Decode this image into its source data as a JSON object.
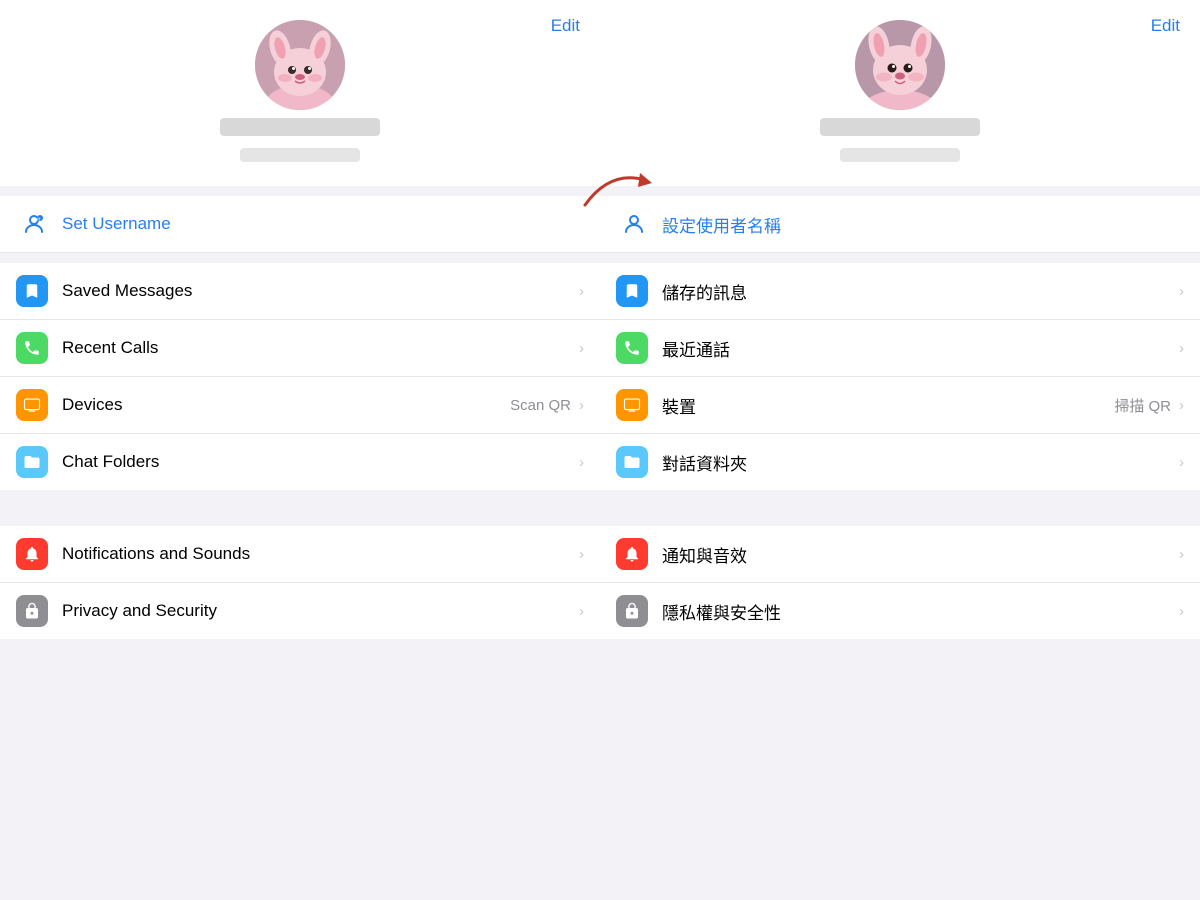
{
  "left": {
    "edit_label": "Edit",
    "username_icon": "👤",
    "username_label": "Set Username",
    "menu_items": [
      {
        "id": "saved-messages",
        "icon": "🔖",
        "icon_class": "icon-blue",
        "label": "Saved Messages",
        "secondary": "",
        "chevron": "›"
      },
      {
        "id": "recent-calls",
        "icon": "📞",
        "icon_class": "icon-green",
        "label": "Recent Calls",
        "secondary": "",
        "chevron": "›"
      },
      {
        "id": "devices",
        "icon": "🖥",
        "icon_class": "icon-orange",
        "label": "Devices",
        "secondary": "Scan QR",
        "chevron": "›"
      },
      {
        "id": "chat-folders",
        "icon": "📁",
        "icon_class": "icon-teal",
        "label": "Chat Folders",
        "secondary": "",
        "chevron": "›"
      }
    ],
    "menu_items2": [
      {
        "id": "notifications",
        "icon": "🔔",
        "icon_class": "icon-red",
        "label": "Notifications and Sounds",
        "secondary": "",
        "chevron": "›"
      },
      {
        "id": "privacy",
        "icon": "🔒",
        "icon_class": "icon-gray",
        "label": "Privacy and Security",
        "secondary": "",
        "chevron": "›"
      }
    ]
  },
  "right": {
    "edit_label": "Edit",
    "username_icon": "👤",
    "username_label": "設定使用者名稱",
    "menu_items": [
      {
        "id": "saved-messages-tw",
        "icon": "🔖",
        "icon_class": "icon-blue",
        "label": "儲存的訊息",
        "secondary": "",
        "chevron": "›"
      },
      {
        "id": "recent-calls-tw",
        "icon": "📞",
        "icon_class": "icon-green",
        "label": "最近通話",
        "secondary": "",
        "chevron": "›"
      },
      {
        "id": "devices-tw",
        "icon": "🖥",
        "icon_class": "icon-orange",
        "label": "裝置",
        "secondary": "掃描 QR",
        "chevron": "›"
      },
      {
        "id": "chat-folders-tw",
        "icon": "📁",
        "icon_class": "icon-teal",
        "label": "對話資料夾",
        "secondary": "",
        "chevron": "›"
      }
    ],
    "menu_items2": [
      {
        "id": "notifications-tw",
        "icon": "🔔",
        "icon_class": "icon-red",
        "label": "通知與音效",
        "secondary": "",
        "chevron": "›"
      },
      {
        "id": "privacy-tw",
        "icon": "🔒",
        "icon_class": "icon-gray",
        "label": "隱私權與安全性",
        "secondary": "",
        "chevron": "›"
      }
    ]
  },
  "arrow": {
    "color": "#c0392b"
  },
  "accent_color": "#2680eb"
}
